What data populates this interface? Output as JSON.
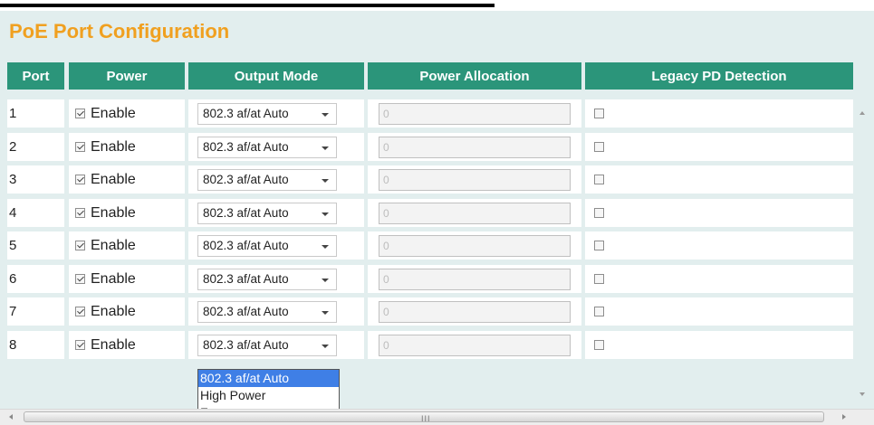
{
  "page": {
    "title": "PoE Port Configuration"
  },
  "table": {
    "headers": {
      "port": "Port",
      "power": "Power",
      "output_mode": "Output Mode",
      "power_allocation": "Power Allocation",
      "legacy_pd_detection": "Legacy PD Detection"
    },
    "rows": [
      {
        "port": "1",
        "power_label": "Enable",
        "power_checked": true,
        "output_mode": "802.3 af/at Auto",
        "power_allocation": "0",
        "legacy_checked": false
      },
      {
        "port": "2",
        "power_label": "Enable",
        "power_checked": true,
        "output_mode": "802.3 af/at Auto",
        "power_allocation": "0",
        "legacy_checked": false
      },
      {
        "port": "3",
        "power_label": "Enable",
        "power_checked": true,
        "output_mode": "802.3 af/at Auto",
        "power_allocation": "0",
        "legacy_checked": false
      },
      {
        "port": "4",
        "power_label": "Enable",
        "power_checked": true,
        "output_mode": "802.3 af/at Auto",
        "power_allocation": "0",
        "legacy_checked": false
      },
      {
        "port": "5",
        "power_label": "Enable",
        "power_checked": true,
        "output_mode": "802.3 af/at Auto",
        "power_allocation": "0",
        "legacy_checked": false
      },
      {
        "port": "6",
        "power_label": "Enable",
        "power_checked": true,
        "output_mode": "802.3 af/at Auto",
        "power_allocation": "0",
        "legacy_checked": false
      },
      {
        "port": "7",
        "power_label": "Enable",
        "power_checked": true,
        "output_mode": "802.3 af/at Auto",
        "power_allocation": "0",
        "legacy_checked": false
      },
      {
        "port": "8",
        "power_label": "Enable",
        "power_checked": true,
        "output_mode": "802.3 af/at Auto",
        "power_allocation": "0",
        "legacy_checked": false
      }
    ]
  },
  "dropdown": {
    "options": [
      "802.3 af/at Auto",
      "High Power",
      "Force"
    ],
    "selected": "802.3 af/at Auto"
  },
  "colors": {
    "header_bg": "#2b957a",
    "title": "#f0a020",
    "panel_bg": "#e2eeee",
    "option_highlight": "#3f7fe6"
  },
  "scrollbar": {
    "grip": "III"
  }
}
